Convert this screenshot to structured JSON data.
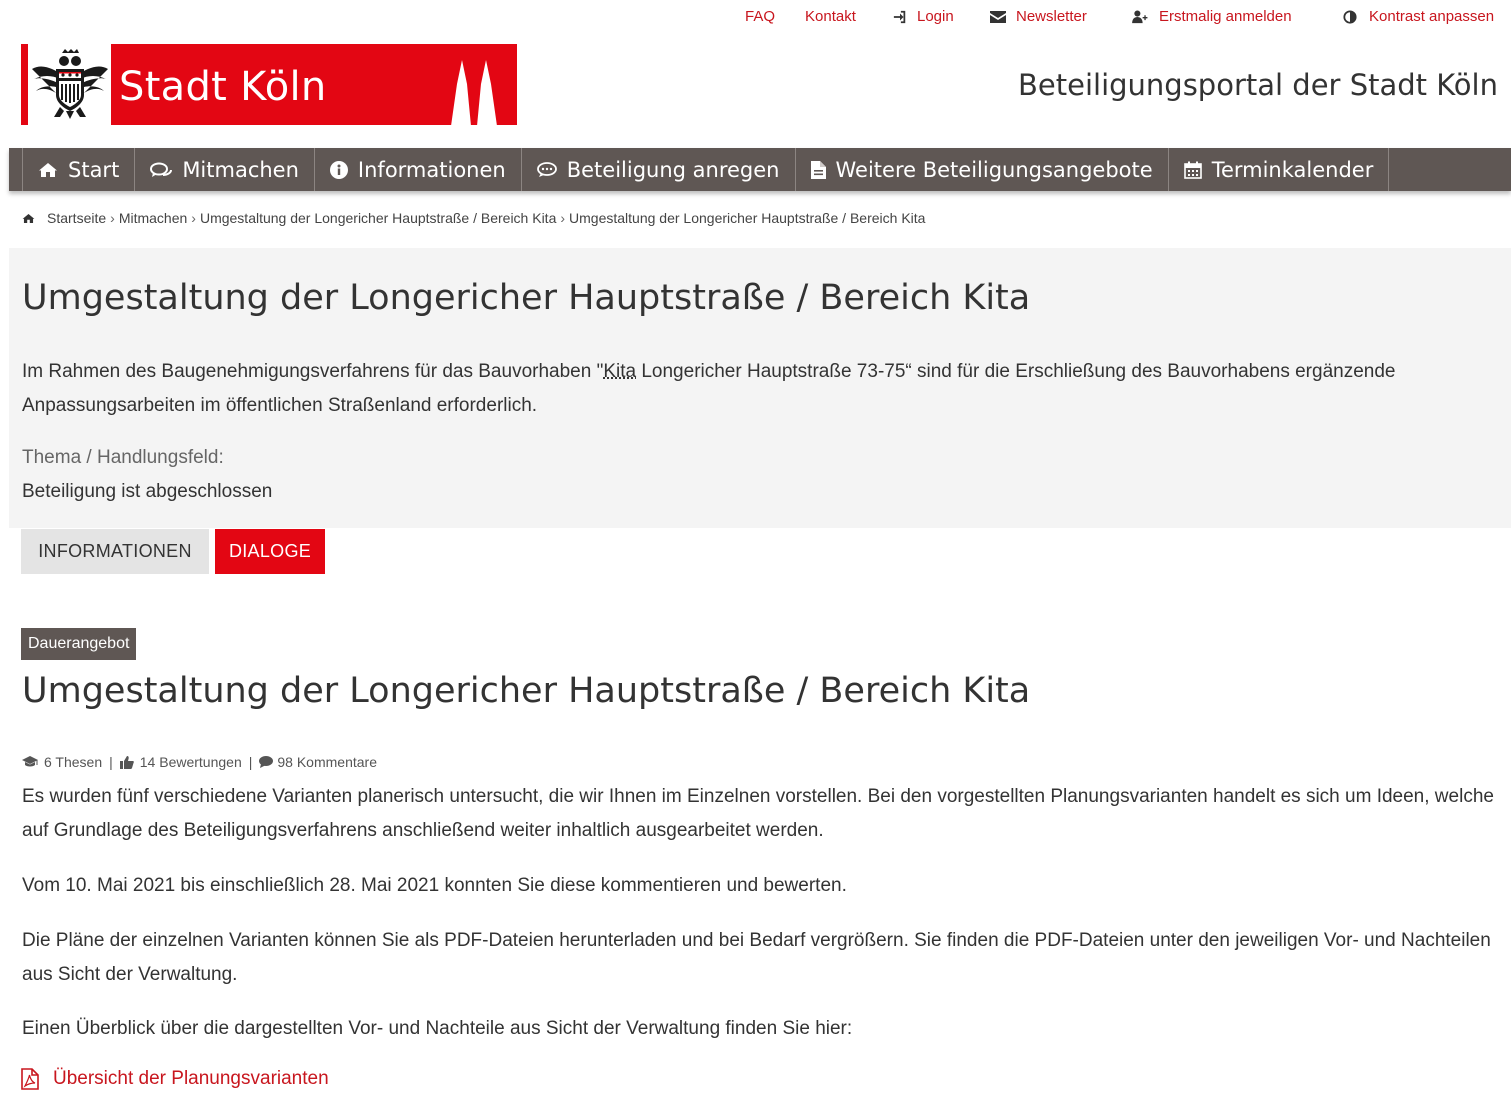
{
  "toplinks": {
    "faq": "FAQ",
    "kontakt": "Kontakt",
    "login": "Login",
    "newsletter": "Newsletter",
    "register": "Erstmalig anmelden",
    "contrast": "Kontrast anpassen"
  },
  "logo": {
    "name": "Stadt Köln"
  },
  "portal_title": "Beteiligungsportal der Stadt Köln",
  "nav": {
    "start": "Start",
    "mitmachen": "Mitmachen",
    "informationen": "Informationen",
    "anregen": "Beteiligung anregen",
    "weitere": "Weitere Beteiligungsangebote",
    "termine": "Terminkalender"
  },
  "breadcrumb": {
    "home": "Startseite",
    "mitmachen": "Mitmachen",
    "level2": "Umgestaltung der Longericher Hauptstraße / Bereich Kita",
    "current": "Umgestaltung der Longericher Hauptstraße / Bereich Kita"
  },
  "header": {
    "title": "Umgestaltung der Longericher Hauptstraße / Bereich Kita",
    "intro_a": "Im Rahmen des Baugenehmigungsverfahrens für das Bauvorhaben \"",
    "intro_abbr": "Kita",
    "intro_b": " Longericher Hauptstraße 73-75“ sind für die Erschließung des Bauvorhabens ergänzende Anpassungsarbeiten im öffentlichen Straßenland erforderlich.",
    "thema_label": "Thema / Handlungsfeld:",
    "status": "Beteiligung ist abgeschlossen"
  },
  "tabs": {
    "informationen": "INFORMATIONEN",
    "dialoge": "DIALOGE"
  },
  "dialog": {
    "badge": "Dauerangebot",
    "title": "Umgestaltung der Longericher Hauptstraße / Bereich Kita",
    "stats": {
      "thesen": "6 Thesen",
      "bewertungen": "14 Bewertungen",
      "kommentare": "98 Kommentare"
    },
    "p1": "Es wurden fünf verschiedene Varianten planerisch untersucht, die wir Ihnen im Einzelnen vorstellen. Bei den vorgestellten Planungsvarianten handelt es sich um Ideen, welche auf Grundlage des Beteiligungsverfahrens anschließend weiter inhaltlich ausgearbeitet werden.",
    "p2": "Vom 10. Mai 2021 bis einschließlich 28. Mai 2021 konnten Sie diese kommentieren und bewerten.",
    "p3": "Die Pläne der einzelnen Varianten können Sie als PDF-Dateien herunterladen und bei Bedarf vergrößern. Sie finden die PDF-Dateien unter den jeweiligen Vor- und Nachteilen aus Sicht der Verwaltung.",
    "p4": "Einen Überblick über die dargestellten Vor- und Nachteile aus Sicht der Verwaltung finden Sie hier:",
    "pdf_link": "Übersicht der Planungsvarianten"
  },
  "colors": {
    "brand_red": "#e30613",
    "link_red": "#c8161e",
    "nav_bg": "#5f5754",
    "panel_bg": "#f4f4f4"
  },
  "icons": [
    "sign-in-icon",
    "envelope-icon",
    "user-plus-icon",
    "adjust-icon",
    "home-icon",
    "comments-icon",
    "info-circle-icon",
    "comment-dots-icon",
    "file-icon",
    "calendar-icon",
    "graduation-cap-icon",
    "thumbs-up-icon",
    "comment-icon",
    "file-pdf-icon",
    "coat-of-arms-icon",
    "cathedral-icon"
  ]
}
